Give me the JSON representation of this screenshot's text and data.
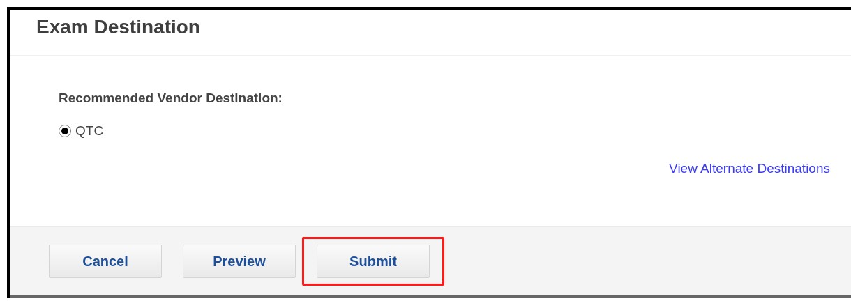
{
  "panel": {
    "title": "Exam Destination"
  },
  "vendor": {
    "label": "Recommended Vendor Destination:",
    "options": [
      {
        "label": "QTC",
        "selected": true
      }
    ]
  },
  "link": "View Alternate Destinations",
  "buttons": [
    {
      "label": "Cancel",
      "highlighted": false
    },
    {
      "label": "Preview",
      "highlighted": false
    },
    {
      "label": "Submit",
      "highlighted": true
    }
  ]
}
